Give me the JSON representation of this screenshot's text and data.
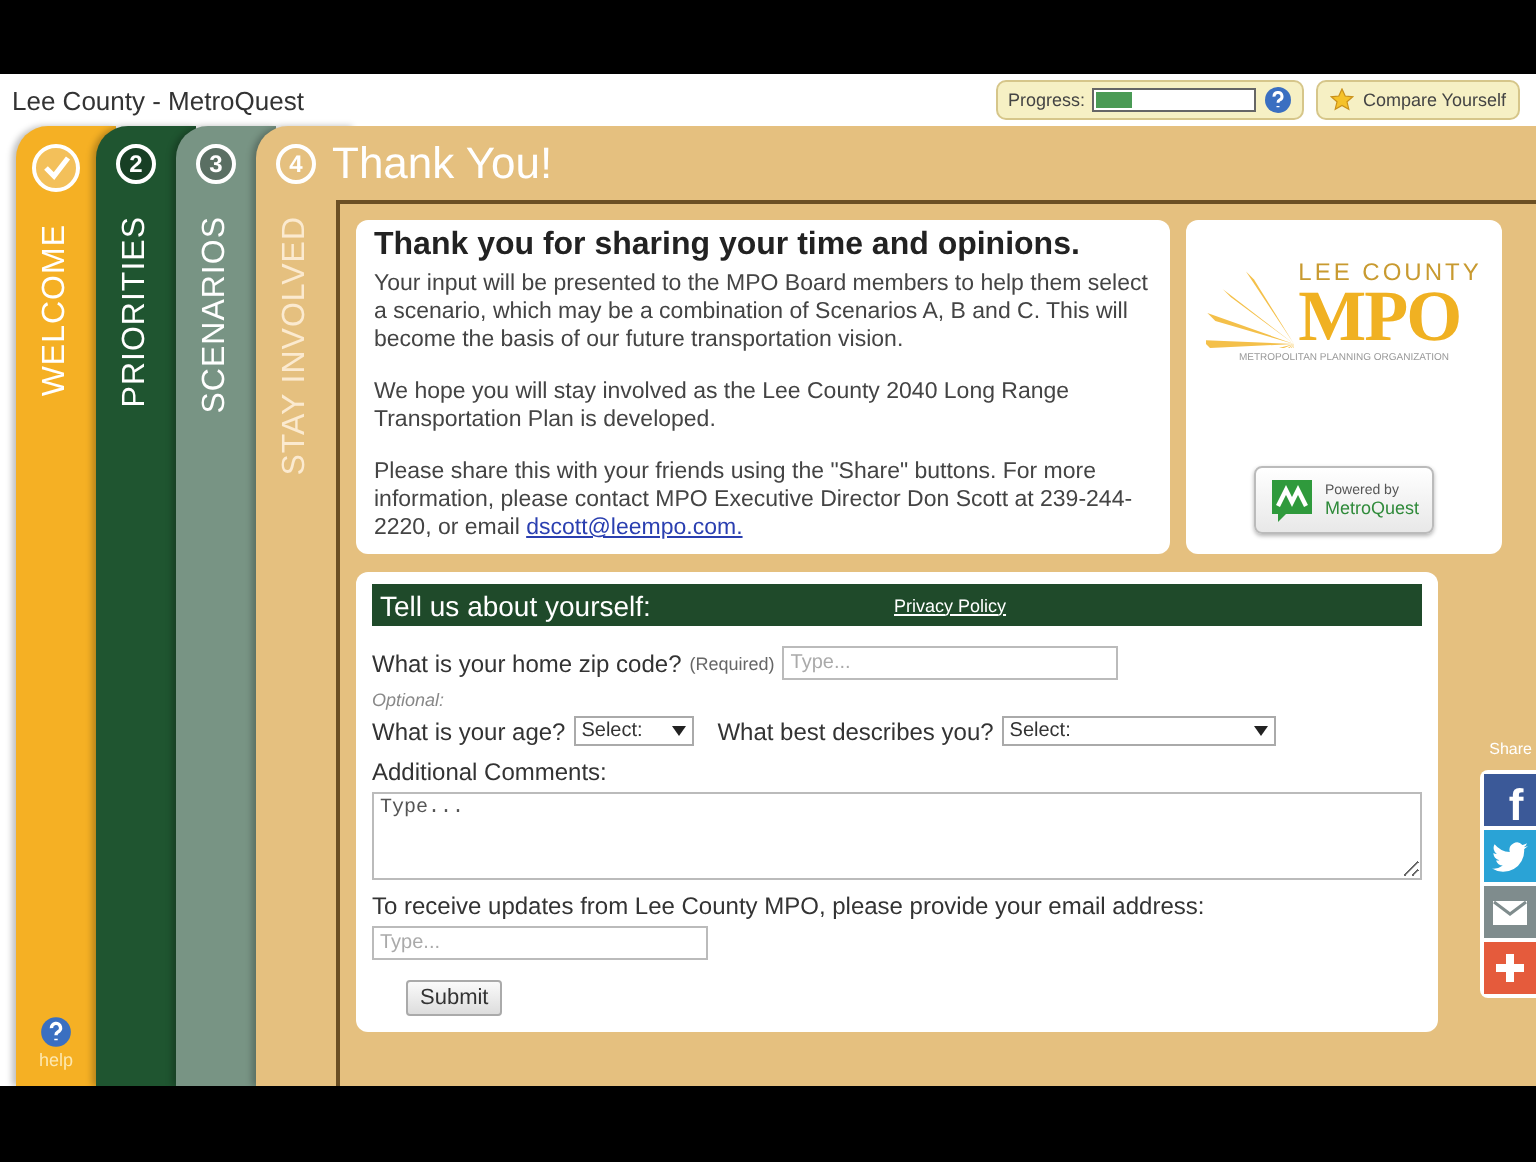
{
  "window": {
    "title": "Lee County - MetroQuest"
  },
  "progress": {
    "label": "Progress:",
    "level": 0.25
  },
  "compare_button": {
    "label": "Compare Yourself"
  },
  "steps": [
    {
      "kind": "done",
      "label": "WELCOME",
      "selected": false
    },
    {
      "kind": "number",
      "number": "2",
      "label": "PRIORITIES",
      "selected": false
    },
    {
      "kind": "number",
      "number": "3",
      "label": "SCENARIOS",
      "selected": false
    },
    {
      "kind": "number",
      "number": "4",
      "label": "STAY INVOLVED",
      "selected": true
    }
  ],
  "help": {
    "label": "help"
  },
  "page_title": "Thank You!",
  "message": {
    "heading": "Thank you for sharing your time and opinions.",
    "paragraphs": [
      "Your input will be presented to the MPO Board members to help them select a scenario, which may be a combination of Scenarios A, B and C. This will become the basis of our future transportation vision.",
      "We hope you will stay involved as the Lee County 2040 Long Range Transportation Plan is developed."
    ],
    "contact": {
      "text": "Please share this with your friends using the \"Share\" buttons. For more information, please contact MPO Executive Director Don Scott at 239-244-2220, or email ",
      "link": "dscott@leempo.com."
    }
  },
  "logo": {
    "line1": "LEE COUNTY",
    "line2": "MPO",
    "line3": "METROPOLITAN PLANNING ORGANIZATION"
  },
  "powered_by": {
    "line1": "Powered by",
    "line2": "MetroQuest"
  },
  "form": {
    "heading": "Tell us about yourself:",
    "privacy_link": "Privacy Policy",
    "zip": {
      "label": "What is your home zip code?",
      "note": "(Required)",
      "placeholder": "Type..."
    },
    "optional_label": "Optional:",
    "age": {
      "label": "What is your age?",
      "value": "Select:"
    },
    "describe": {
      "label": "What best describes you?",
      "value": "Select:"
    },
    "comments": {
      "label": "Additional Comments:",
      "placeholder": "Type..."
    },
    "email": {
      "label": "To receive updates from Lee County MPO, please provide your email address:",
      "placeholder": "Type..."
    },
    "submit": "Submit"
  },
  "share": {
    "label": "Share",
    "buttons": [
      {
        "kind": "facebook",
        "glyph": "f",
        "color": "#3b5998"
      },
      {
        "kind": "twitter",
        "color": "#2aa3d6"
      },
      {
        "kind": "email",
        "color": "#7f8c8d"
      },
      {
        "kind": "more",
        "color": "#e55b3c"
      }
    ]
  }
}
